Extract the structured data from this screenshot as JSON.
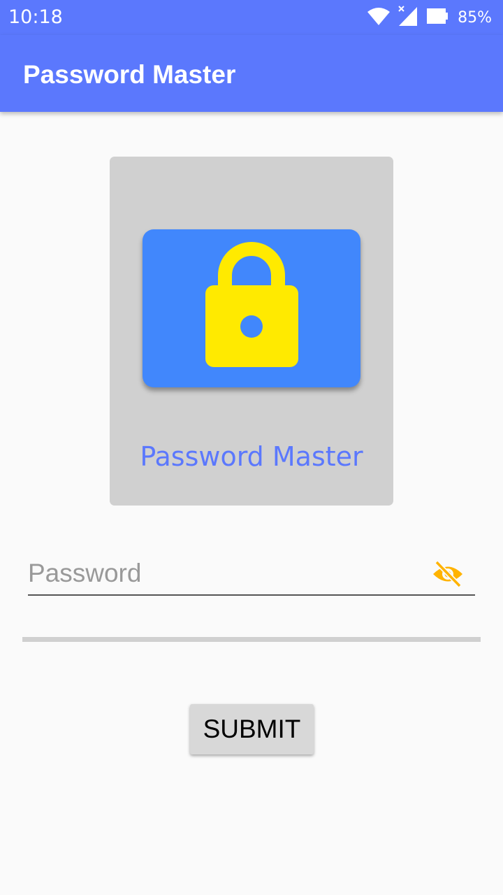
{
  "status_bar": {
    "time": "10:18",
    "battery_percent": "85%",
    "icons": [
      "wifi-icon",
      "cell-signal-icon",
      "battery-icon"
    ]
  },
  "app_bar": {
    "title": "Password Master"
  },
  "logo": {
    "icon": "lock-icon",
    "caption": "Password Master"
  },
  "password": {
    "placeholder": "Password",
    "value": "",
    "toggle_icon": "eye-off-icon"
  },
  "submit": {
    "label": "SUBMIT"
  },
  "colors": {
    "primary": "#5b78fd",
    "tile": "#4187fc",
    "lock": "#ffea00",
    "eye_toggle": "#ffb300",
    "card": "#d0d0d0",
    "button": "#d8d8d8"
  }
}
